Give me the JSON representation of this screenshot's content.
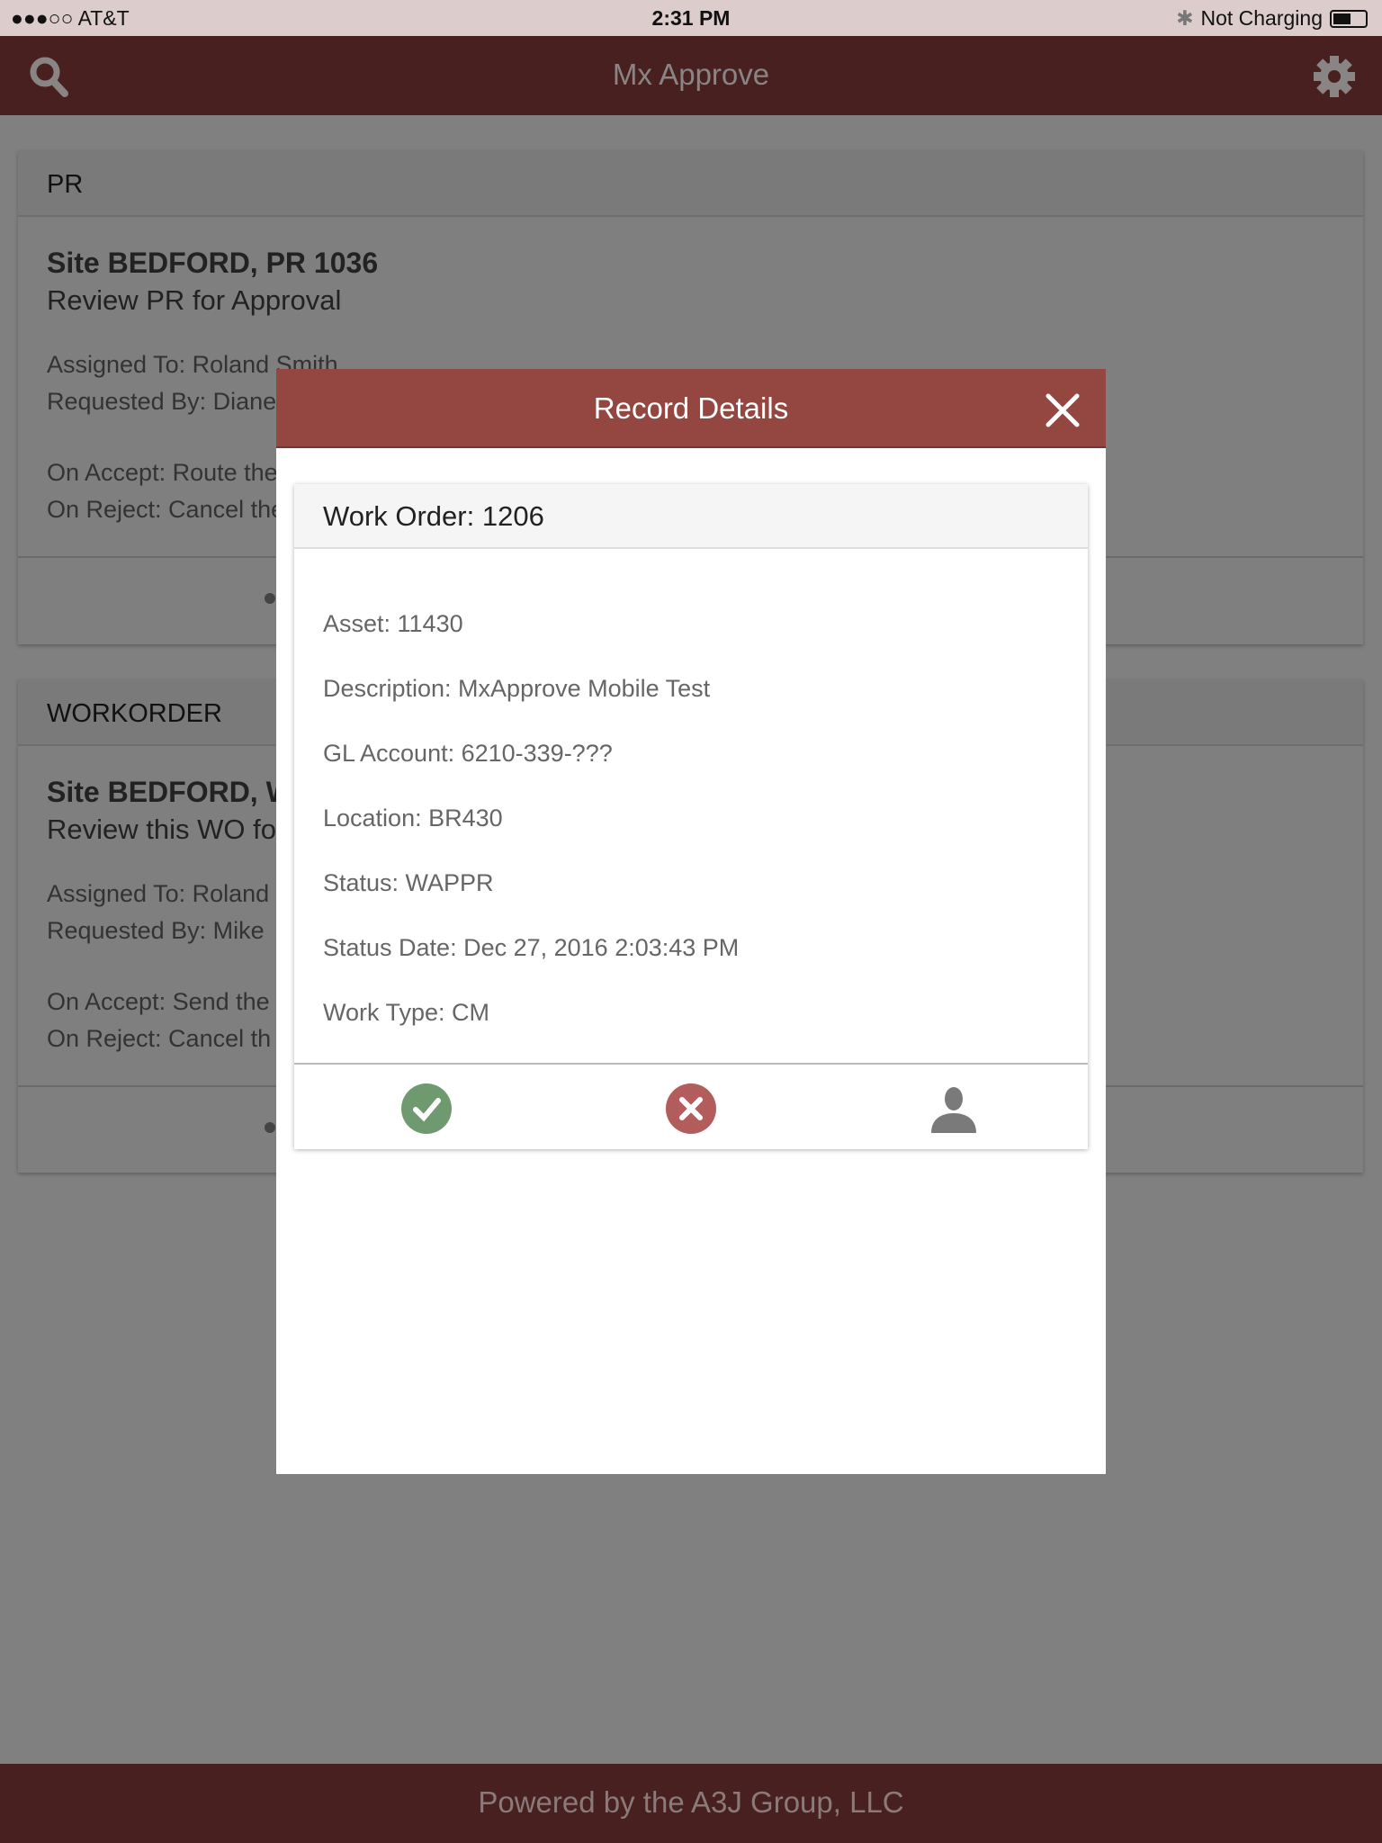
{
  "status_bar": {
    "carrier": "●●●○○ AT&T",
    "time": "2:31 PM",
    "charging": "Not Charging",
    "battery_level": 0.5
  },
  "header": {
    "title": "Mx Approve",
    "left_icon": "search-icon",
    "right_icon": "gear-icon"
  },
  "cards": [
    {
      "type": "PR",
      "title": "Site BEDFORD, PR 1036",
      "subtitle": "Review PR for Approval",
      "assigned": "Assigned To: Roland Smith",
      "requested": "Requested By: Diane",
      "on_accept": "On Accept: Route the",
      "on_reject": "On Reject: Cancel the"
    },
    {
      "type": "WORKORDER",
      "title": "Site BEDFORD, W",
      "subtitle": "Review this WO fo",
      "assigned": "Assigned To: Roland",
      "requested": "Requested By: Mike",
      "on_accept": "On Accept: Send the",
      "on_reject": "On Reject: Cancel th"
    }
  ],
  "modal": {
    "title": "Record Details",
    "record_title": "Work Order: 1206",
    "fields": [
      "Asset: 11430",
      "Description: MxApprove Mobile Test",
      "GL Account: 6210-339-???",
      "Location: BR430",
      "Status: WAPPR",
      "Status Date: Dec 27, 2016 2:03:43 PM",
      "Work Type: CM"
    ],
    "actions": {
      "approve_color": "#6f9a6f",
      "reject_color": "#b35c5c",
      "assign_color": "#7a7a7a"
    }
  },
  "footer": {
    "text": "Powered by the A3J Group, LLC"
  }
}
